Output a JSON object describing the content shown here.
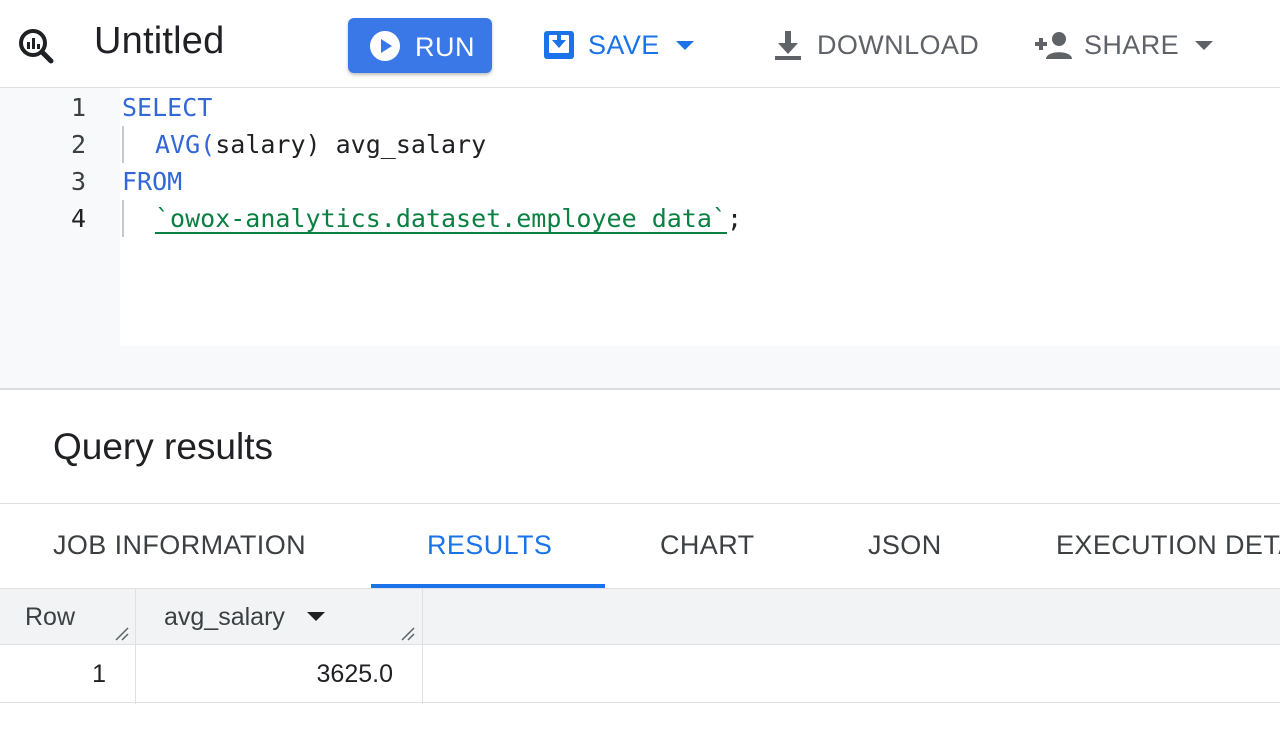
{
  "toolbar": {
    "title": "Untitled",
    "run_label": "RUN",
    "save_label": "SAVE",
    "download_label": "DOWNLOAD",
    "share_label": "SHARE"
  },
  "editor": {
    "lines": [
      {
        "number": "1",
        "keyword": "SELECT",
        "text": ""
      },
      {
        "number": "2",
        "keyword": "AVG(",
        "text": "salary) avg_salary"
      },
      {
        "number": "3",
        "keyword": "FROM",
        "text": ""
      },
      {
        "number": "4",
        "string": "`owox-analytics.dataset.employee_data`",
        "text": ";"
      }
    ]
  },
  "results": {
    "title": "Query results",
    "tabs": [
      {
        "label": "JOB INFORMATION",
        "active": false
      },
      {
        "label": "RESULTS",
        "active": true
      },
      {
        "label": "CHART",
        "active": false
      },
      {
        "label": "JSON",
        "active": false
      },
      {
        "label": "EXECUTION DETA",
        "active": false
      }
    ],
    "columns": [
      "Row",
      "avg_salary"
    ],
    "rows": [
      {
        "row": "1",
        "avg_salary": "3625.0"
      }
    ]
  },
  "colors": {
    "accent": "#1a73e8",
    "run_button": "#3b78e7",
    "keyword": "#3367d6",
    "string": "#0b8043"
  }
}
